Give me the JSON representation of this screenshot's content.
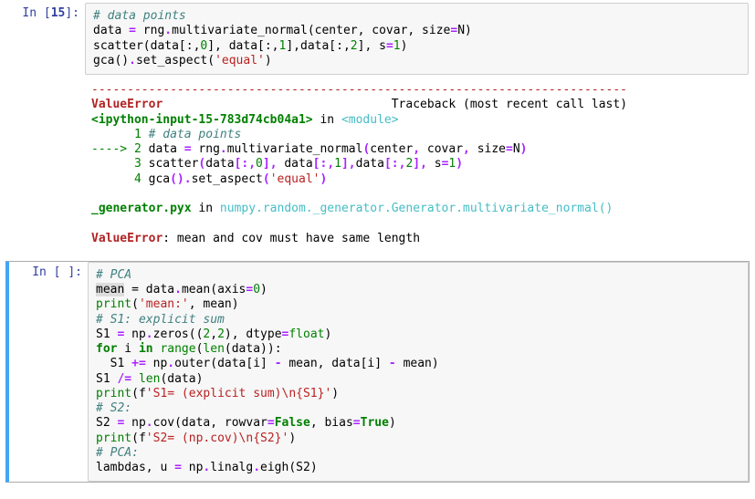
{
  "cell1": {
    "prompt_label": "In [",
    "prompt_num": "15",
    "prompt_close": "]:",
    "code": {
      "l1": "# data points",
      "l2a": "data ",
      "l2op": "=",
      "l2b": " rng",
      "l2dot1": ".",
      "l2c": "multivariate_normal(center, covar, size",
      "l2eq2": "=",
      "l2d": "N)",
      "l3a": "scatter(data[:,",
      "l3n0": "0",
      "l3b": "], data[:,",
      "l3n1": "1",
      "l3c": "],data[:,",
      "l3n2": "2",
      "l3d": "], s",
      "l3eq": "=",
      "l3e": "1",
      "l3f": ")",
      "l4a": "gca()",
      "l4dot": ".",
      "l4b": "set_aspect(",
      "l4s": "'equal'",
      "l4c": ")"
    },
    "tb": {
      "dash": "---------------------------------------------------------------------------",
      "errname": "ValueError",
      "trace_label": "Traceback (most recent call last)",
      "file_line_a": "<ipython-input-15-783d74cb04a1>",
      "file_line_b": " in ",
      "file_line_c": "<module>",
      "l1_num": "      1 ",
      "l1_txt": "# data points",
      "arrow": "----> ",
      "l2_num": "2 ",
      "l2_txt_a": "data ",
      "l2_txt_b": " rng",
      "l2_txt_c": "multivariate_normal",
      "l2_txt_d": "center",
      "l2_txt_e": " covar",
      "l2_txt_f": " size",
      "l2_txt_g": "N",
      "l3_num": "      3 ",
      "l3_txt_a": "scatter",
      "l3_txt_b": "data",
      "l3_txt_c": " data",
      "l3_txt_d": "data",
      "l3_txt_e": " s",
      "l4_num": "      4 ",
      "l4_txt_a": "gca",
      "l4_txt_b": "set_aspect",
      "gen_a": "_generator.pyx",
      "gen_b": " in ",
      "gen_c": "numpy.random._generator.Generator.multivariate_normal",
      "gen_d": "()",
      "final_err": "ValueError",
      "final_msg": ": mean and cov must have same length"
    }
  },
  "cell2": {
    "prompt_label": "In [",
    "prompt_space": " ",
    "prompt_close": "]:",
    "code": {
      "l1": "# PCA",
      "l2a": "mean",
      "l2op": " = ",
      "l2b": "data",
      "l2dot": ".",
      "l2c": "mean(axis",
      "l2eq": "=",
      "l2n": "0",
      "l2d": ")",
      "l3a": "print",
      "l3b": "(",
      "l3s": "'mean:'",
      "l3c": ", mean)",
      "l4": "# S1: explicit sum",
      "l5a": "S1 ",
      "l5op": "=",
      "l5b": " np",
      "l5dot": ".",
      "l5c": "zeros((",
      "l5n1": "2",
      "l5d": ",",
      "l5n2": "2",
      "l5e": "), dtype",
      "l5eq": "=",
      "l5f": "float",
      "l5g": ")",
      "l6a": "for",
      "l6b": " i ",
      "l6c": "in",
      "l6d": " ",
      "l6e": "range",
      "l6f": "(",
      "l6g": "len",
      "l6h": "(data)):",
      "l7a": "  S1 ",
      "l7op": "+=",
      "l7b": " np",
      "l7dot": ".",
      "l7c": "outer(data[i] ",
      "l7m1": "-",
      "l7d": " mean, data[i] ",
      "l7m2": "-",
      "l7e": " mean)",
      "l8a": "S1 ",
      "l8op": "/=",
      "l8b": " ",
      "l8c": "len",
      "l8d": "(data)",
      "l9a": "print",
      "l9b": "(f",
      "l9s": "'S1= (explicit sum)\\n{S1}'",
      "l9c": ")",
      "l10": "# S2:",
      "l11a": "S2 ",
      "l11op": "=",
      "l11b": " np",
      "l11dot": ".",
      "l11c": "cov(data, rowvar",
      "l11eq1": "=",
      "l11d": "False",
      "l11e": ", bias",
      "l11eq2": "=",
      "l11f": "True",
      "l11g": ")",
      "l12a": "print",
      "l12b": "(f",
      "l12s": "'S2= (np.cov)\\n{S2}'",
      "l12c": ")",
      "l13": "# PCA:",
      "l14a": "lambdas, u ",
      "l14op": "=",
      "l14b": " np",
      "l14dot": ".",
      "l14c": "linalg",
      "l14dot2": ".",
      "l14d": "eigh(S2)"
    }
  }
}
